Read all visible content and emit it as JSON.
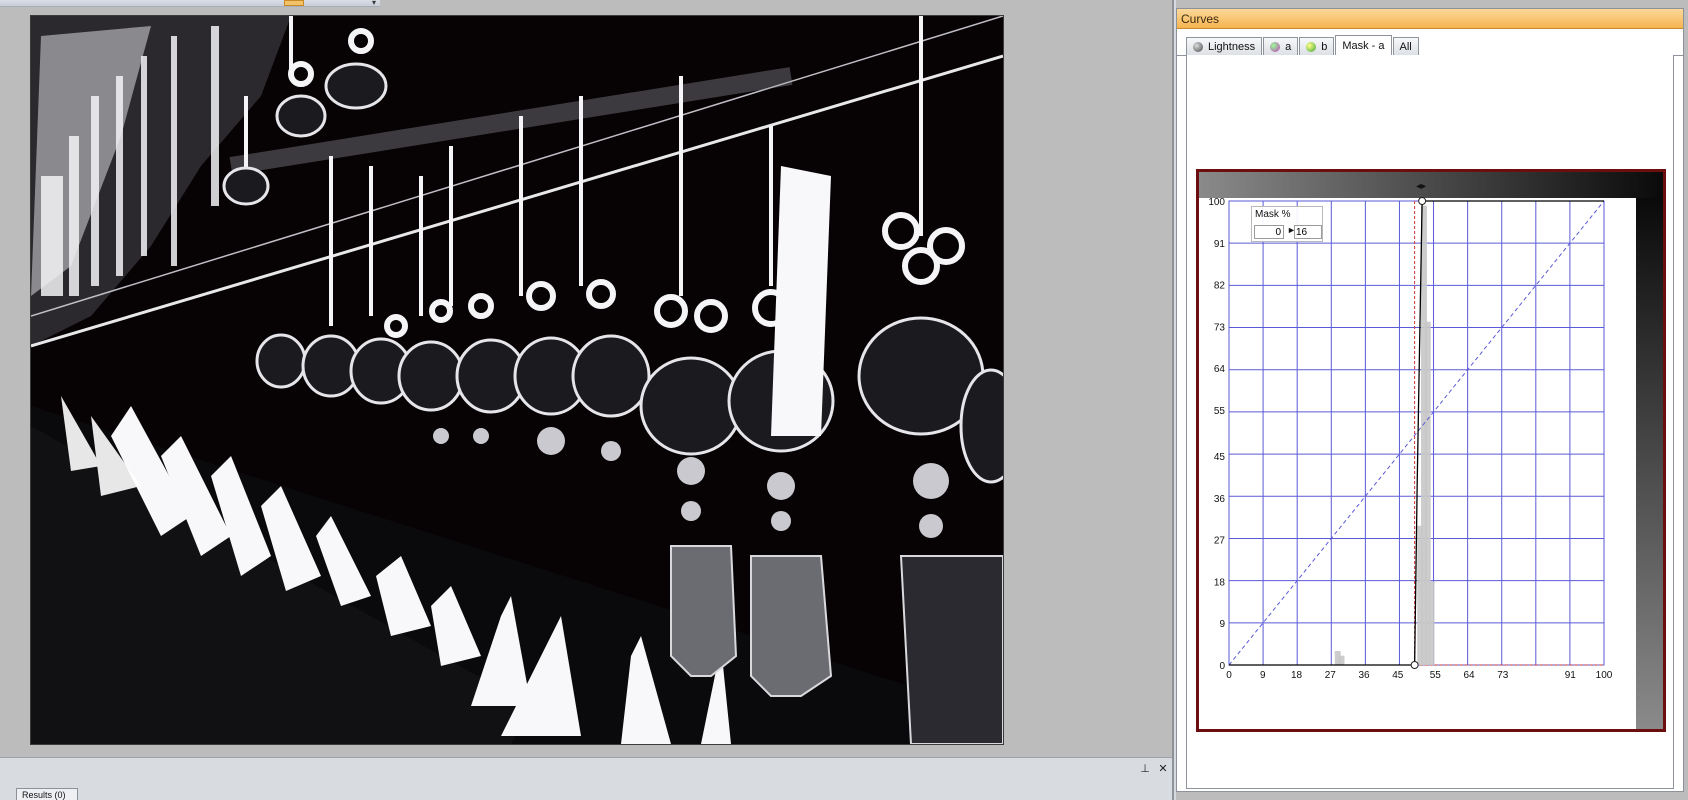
{
  "panel": {
    "title": "Curves",
    "tabs": [
      {
        "label": "Lightness",
        "icon": "lightness-channel-icon",
        "color": "#5a5a5a",
        "active": false
      },
      {
        "label": "a",
        "icon": "a-channel-icon",
        "color": "#c23cb8",
        "active": false
      },
      {
        "label": "b",
        "icon": "b-channel-icon",
        "color": "#3aa53a",
        "active": false
      },
      {
        "label": "Mask - a",
        "icon": "",
        "color": "",
        "active": true
      },
      {
        "label": "All",
        "icon": "",
        "color": "",
        "active": false
      }
    ]
  },
  "curve": {
    "mask_label": "Mask %",
    "mask_from": "0",
    "mask_arrow": "►",
    "mask_to": "16",
    "x_ticks": [
      "0",
      "9",
      "18",
      "27",
      "36",
      "45",
      "55",
      "64",
      "73",
      "91",
      "100"
    ],
    "x_tick_values": [
      0,
      9,
      18,
      27,
      36,
      45,
      55,
      64,
      73,
      91,
      100
    ],
    "y_ticks": [
      "100",
      "91",
      "82",
      "73",
      "64",
      "55",
      "45",
      "36",
      "27",
      "18",
      "9",
      "0"
    ],
    "y_tick_values": [
      100,
      91,
      82,
      73,
      64,
      55,
      45,
      36,
      27,
      18,
      9,
      0
    ],
    "curve_points": [
      [
        0,
        0
      ],
      [
        49.5,
        0
      ],
      [
        50.2,
        40
      ],
      [
        51.5,
        100
      ],
      [
        100,
        100
      ]
    ],
    "histogram_peaks": [
      [
        29,
        3
      ],
      [
        30,
        2
      ],
      [
        51,
        30
      ],
      [
        52,
        99
      ],
      [
        53,
        74
      ],
      [
        54,
        18
      ]
    ],
    "grid_color": "#5a5ad8",
    "curve_color": "#000000",
    "frame_color": "#6d0e0e"
  },
  "dock": {
    "pin_icon": "pin-icon",
    "close_icon": "close-icon",
    "pin_glyph": "⊥",
    "close_glyph": "✕",
    "results_tab": "Results (0)"
  }
}
